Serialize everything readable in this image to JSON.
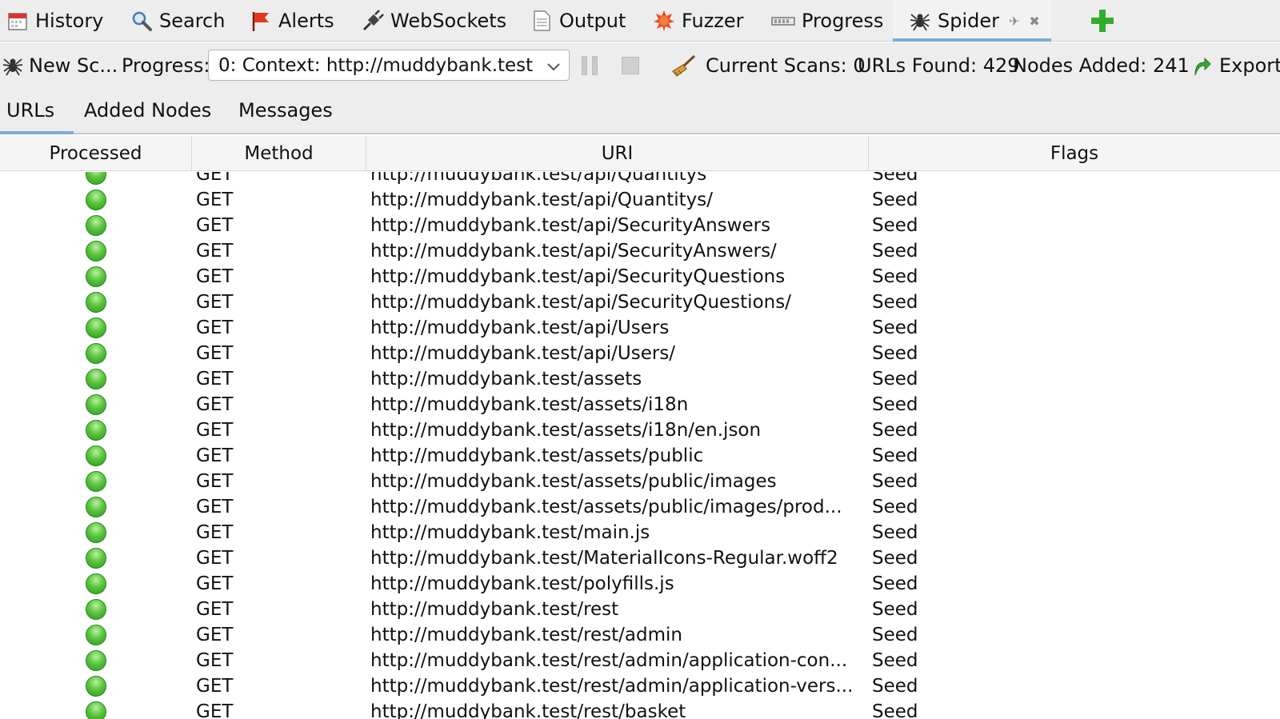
{
  "tabs": [
    {
      "label": "History",
      "icon": "calendar-icon"
    },
    {
      "label": "Search",
      "icon": "magnifier-icon"
    },
    {
      "label": "Alerts",
      "icon": "flag-icon"
    },
    {
      "label": "WebSockets",
      "icon": "plug-icon"
    },
    {
      "label": "Output",
      "icon": "document-icon"
    },
    {
      "label": "Fuzzer",
      "icon": "burst-icon"
    },
    {
      "label": "Progress",
      "icon": "progress-icon"
    },
    {
      "label": "Spider",
      "icon": "spider-icon",
      "active": true
    }
  ],
  "toolbar": {
    "new_scan_label": "New Sc...",
    "progress_label": "Progress:",
    "context_select": "0: Context: http://muddybank.test",
    "current_scans": "Current Scans: 0",
    "urls_found": "URLs Found: 429",
    "nodes_added": "Nodes Added: 241",
    "export_label": "Export"
  },
  "subtabs": [
    {
      "label": "URLs",
      "active": true
    },
    {
      "label": "Added Nodes"
    },
    {
      "label": "Messages"
    }
  ],
  "table": {
    "columns": [
      "Processed",
      "Method",
      "URI",
      "Flags"
    ],
    "rows": [
      {
        "method": "GET",
        "uri": "http://muddybank.test/api/Quantitys",
        "flag": "Seed"
      },
      {
        "method": "GET",
        "uri": "http://muddybank.test/api/Quantitys/",
        "flag": "Seed"
      },
      {
        "method": "GET",
        "uri": "http://muddybank.test/api/SecurityAnswers",
        "flag": "Seed"
      },
      {
        "method": "GET",
        "uri": "http://muddybank.test/api/SecurityAnswers/",
        "flag": "Seed"
      },
      {
        "method": "GET",
        "uri": "http://muddybank.test/api/SecurityQuestions",
        "flag": "Seed"
      },
      {
        "method": "GET",
        "uri": "http://muddybank.test/api/SecurityQuestions/",
        "flag": "Seed"
      },
      {
        "method": "GET",
        "uri": "http://muddybank.test/api/Users",
        "flag": "Seed"
      },
      {
        "method": "GET",
        "uri": "http://muddybank.test/api/Users/",
        "flag": "Seed"
      },
      {
        "method": "GET",
        "uri": "http://muddybank.test/assets",
        "flag": "Seed"
      },
      {
        "method": "GET",
        "uri": "http://muddybank.test/assets/i18n",
        "flag": "Seed"
      },
      {
        "method": "GET",
        "uri": "http://muddybank.test/assets/i18n/en.json",
        "flag": "Seed"
      },
      {
        "method": "GET",
        "uri": "http://muddybank.test/assets/public",
        "flag": "Seed"
      },
      {
        "method": "GET",
        "uri": "http://muddybank.test/assets/public/images",
        "flag": "Seed"
      },
      {
        "method": "GET",
        "uri": "http://muddybank.test/assets/public/images/prod...",
        "flag": "Seed"
      },
      {
        "method": "GET",
        "uri": "http://muddybank.test/main.js",
        "flag": "Seed"
      },
      {
        "method": "GET",
        "uri": "http://muddybank.test/MaterialIcons-Regular.woff2",
        "flag": "Seed"
      },
      {
        "method": "GET",
        "uri": "http://muddybank.test/polyfills.js",
        "flag": "Seed"
      },
      {
        "method": "GET",
        "uri": "http://muddybank.test/rest",
        "flag": "Seed"
      },
      {
        "method": "GET",
        "uri": "http://muddybank.test/rest/admin",
        "flag": "Seed"
      },
      {
        "method": "GET",
        "uri": "http://muddybank.test/rest/admin/application-con...",
        "flag": "Seed"
      },
      {
        "method": "GET",
        "uri": "http://muddybank.test/rest/admin/application-vers...",
        "flag": "Seed"
      },
      {
        "method": "GET",
        "uri": "http://muddybank.test/rest/basket",
        "flag": "Seed"
      }
    ]
  }
}
